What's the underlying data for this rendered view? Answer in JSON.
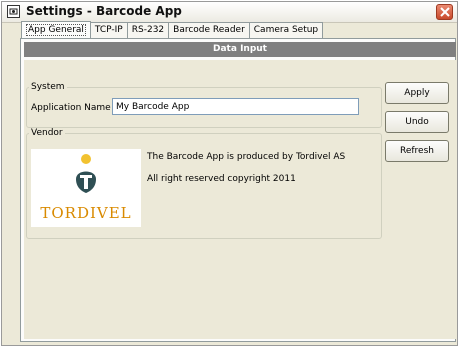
{
  "window": {
    "title": "Settings - Barcode App"
  },
  "tabs": [
    {
      "label": "App General",
      "active": true
    },
    {
      "label": "TCP-IP",
      "active": false
    },
    {
      "label": "RS-232",
      "active": false
    },
    {
      "label": "Barcode Reader",
      "active": false
    },
    {
      "label": "Camera Setup",
      "active": false
    }
  ],
  "header": {
    "title": "Data Input"
  },
  "system": {
    "legend": "System",
    "app_name_label": "Application Name",
    "app_name_value": "My Barcode App"
  },
  "vendor": {
    "legend": "Vendor",
    "logo_text": "TORDIVEL",
    "line1": "The Barcode App is produced by Tordivel AS",
    "line2": "All right reserved copyright 2011"
  },
  "buttons": {
    "apply": "Apply",
    "undo": "Undo",
    "refresh": "Refresh"
  },
  "colors": {
    "header_bar": "#808080",
    "logo_accent": "#d98a00",
    "close_button": "#c84a2c"
  },
  "icons": {
    "app": "settings-app-icon",
    "close": "close-icon",
    "logo": "tordivel-logo-icon"
  }
}
